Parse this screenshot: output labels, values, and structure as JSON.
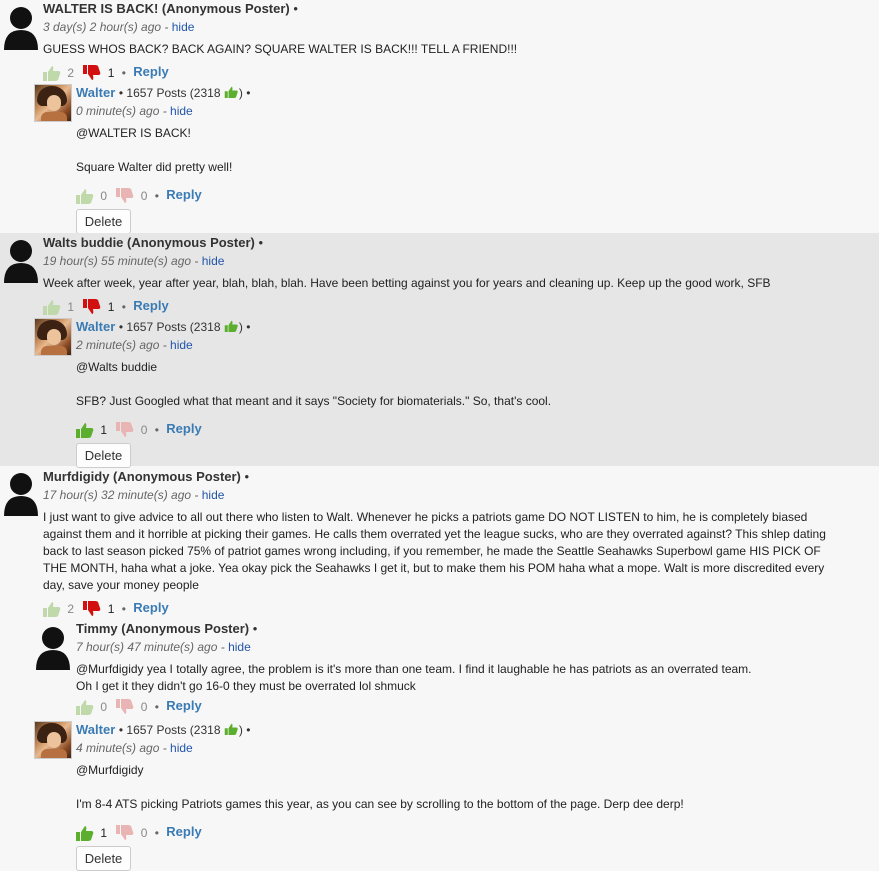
{
  "colors": {
    "link": "#3a7bb5",
    "hide": "#2255aa",
    "like_on": "#5cae2e",
    "like_off": "#bfd9ab",
    "dislike_on": "#d21010",
    "dislike_off": "#e8b4b4",
    "shaded_bg": "#e6e6e6",
    "page_bg": "#f7f7f7"
  },
  "labels": {
    "hide": "hide",
    "reply": "Reply",
    "delete": "Delete",
    "bullet": "•",
    "posts_walter": "1657 Posts (2318"
  },
  "threads": [
    {
      "id": "t1",
      "comment": {
        "author": "WALTER IS BACK! (Anonymous Poster)",
        "time": "3 day(s) 2 hour(s) ago",
        "lines": [
          "GUESS WHOS BACK?  BACK AGAIN? SQUARE WALTER IS BACK!!! TELL A FRIEND!!!"
        ],
        "likes": "2",
        "dislikes": "1"
      },
      "replies": [
        {
          "author": "Walter",
          "posts": "1657 Posts (2318",
          "time": "0 minute(s) ago",
          "lines": [
            "@WALTER IS BACK!",
            "",
            "Square Walter did pretty well!"
          ],
          "likes": "0",
          "dislikes": "0"
        }
      ]
    },
    {
      "id": "t2",
      "comment": {
        "author": "Walts buddie (Anonymous Poster)",
        "time": "19 hour(s) 55 minute(s) ago",
        "lines": [
          "Week after week, year after year, blah, blah, blah. Have been betting against you for years and cleaning up. Keep up the good work, SFB"
        ],
        "likes": "1",
        "dislikes": "1"
      },
      "replies": [
        {
          "author": "Walter",
          "posts": "1657 Posts (2318",
          "time": "2 minute(s) ago",
          "lines": [
            "@Walts buddie",
            "",
            "SFB? Just Googled what that meant and it says \"Society for biomaterials.\" So, that's cool."
          ],
          "likes": "1",
          "dislikes": "0"
        }
      ]
    },
    {
      "id": "t3",
      "comment": {
        "author": "Murfdigidy (Anonymous Poster)",
        "time": "17 hour(s) 32 minute(s) ago",
        "lines": [
          "I just want to give advice to all out there who listen to Walt. Whenever he picks a patriots game DO NOT LISTEN to him, he is completely biased against them and it horrible at picking their games. He calls them overrated yet the league sucks, who are they overrated against? This shlep dating back to last season picked 75% of patriot games wrong including, if you remember, he made the Seattle Seahawks Superbowl game HIS PICK OF THE MONTH, haha what a joke. Yea okay pick the Seahawks I get it, but to make them his POM haha what a mope. Walt is more discredited every day, save your money people"
        ],
        "likes": "2",
        "dislikes": "1"
      },
      "replies": [
        {
          "author": "Timmy (Anonymous Poster)",
          "time": "7 hour(s) 47 minute(s) ago",
          "lines": [
            "@Murfdigidy yea I totally agree, the problem is it's more than one team. I find it laughable he has patriots as an overrated team.",
            "Oh I get it they didn't go 16-0 they must be overrated lol shmuck"
          ],
          "likes": "0",
          "dislikes": "0"
        },
        {
          "author": "Walter",
          "posts": "1657 Posts (2318",
          "time": "4 minute(s) ago",
          "lines": [
            "@Murfdigidy",
            "",
            "I'm 8-4 ATS picking Patriots games this year, as you can see by scrolling to the bottom of the page. Derp dee derp!"
          ],
          "likes": "1",
          "dislikes": "0"
        }
      ]
    }
  ]
}
